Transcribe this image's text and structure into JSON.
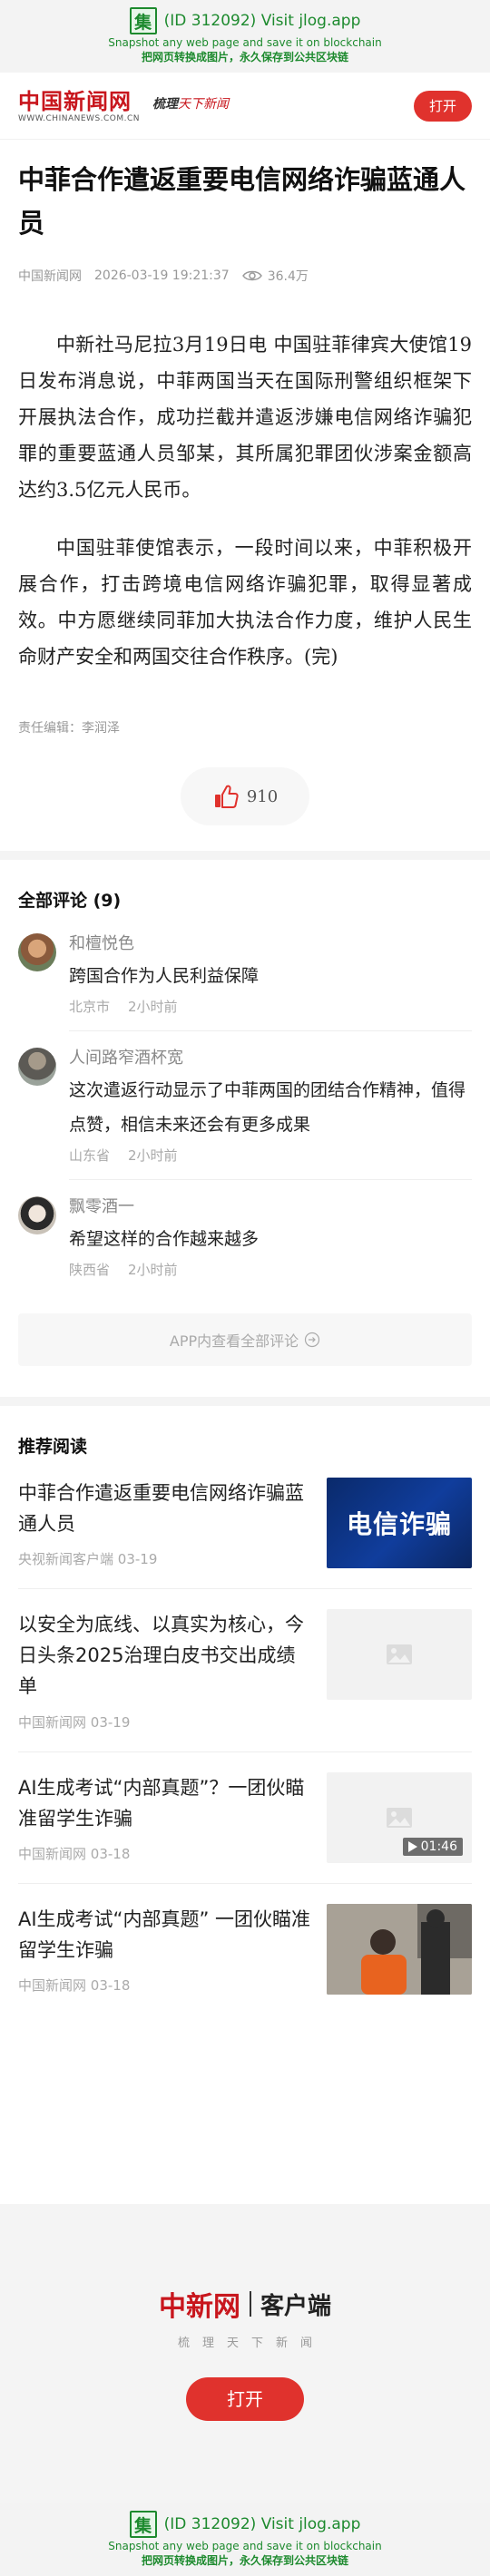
{
  "snapshot_banner": {
    "icon_char": "集",
    "line1": "(ID 312092) Visit jlog.app",
    "line2": "Snapshot any web page and save it on blockchain",
    "line3": "把网页转换成图片，永久保存到公共区块链"
  },
  "header": {
    "logo_cn": "中国新闻网",
    "logo_en": "WWW.CHINANEWS.COM.CN",
    "slogan_a": "梳理",
    "slogan_b": "天下新闻",
    "open_label": "打开"
  },
  "article": {
    "title": "中菲合作遣返重要电信网络诈骗蓝通人员",
    "source": "中国新闻网",
    "datetime": "2026-03-19 19:21:37",
    "views": "36.4万",
    "paragraphs": [
      "中新社马尼拉3月19日电 中国驻菲律宾大使馆19日发布消息说，中菲两国当天在国际刑警组织框架下开展执法合作，成功拦截并遣返涉嫌电信网络诈骗犯罪的重要蓝通人员邹某，其所属犯罪团伙涉案金额高达约3.5亿元人民币。",
      "中国驻菲使馆表示，一段时间以来，中菲积极开展合作，打击跨境电信网络诈骗犯罪，取得显著成效。中方愿继续同菲加大执法合作力度，维护人民生命财产安全和两国交往合作秩序。(完)"
    ],
    "editor": "责任编辑：李润泽",
    "likes": "910"
  },
  "comments": {
    "title": "全部评论 (9)",
    "items": [
      {
        "name": "和檀悦色",
        "text": "跨国合作为人民利益保障",
        "region": "北京市",
        "time": "2小时前"
      },
      {
        "name": "人间路窄酒杯宽",
        "text": "这次遣返行动显示了中菲两国的团结合作精神，值得点赞，相信未来还会有更多成果",
        "region": "山东省",
        "time": "2小时前"
      },
      {
        "name": "飘零酒一",
        "text": "希望这样的合作越来越多",
        "region": "陕西省",
        "time": "2小时前"
      }
    ],
    "view_all": "APP内查看全部评论"
  },
  "recommend": {
    "title": "推荐阅读",
    "items": [
      {
        "title": "中菲合作遣返重要电信网络诈骗蓝通人员",
        "source": "央视新闻客户端",
        "date": "03-19",
        "thumb_text": "电信诈骗"
      },
      {
        "title": "以安全为底线、以真实为核心，今日头条2025治理白皮书交出成绩单",
        "source": "中国新闻网",
        "date": "03-19"
      },
      {
        "title": "AI生成考试“内部真题”？一团伙瞄准留学生诈骗",
        "source": "中国新闻网",
        "date": "03-18",
        "duration": "01:46"
      },
      {
        "title": "AI生成考试“内部真题” 一团伙瞄准留学生诈骗",
        "source": "中国新闻网",
        "date": "03-18"
      }
    ]
  },
  "footer": {
    "logo": "中新网",
    "client": "客户端",
    "tagline": "梳理天下新闻",
    "open_label": "打开"
  },
  "colors": {
    "accent": "#e0322d",
    "brand_red": "#c8161d",
    "banner_green": "#1d8a2e"
  }
}
